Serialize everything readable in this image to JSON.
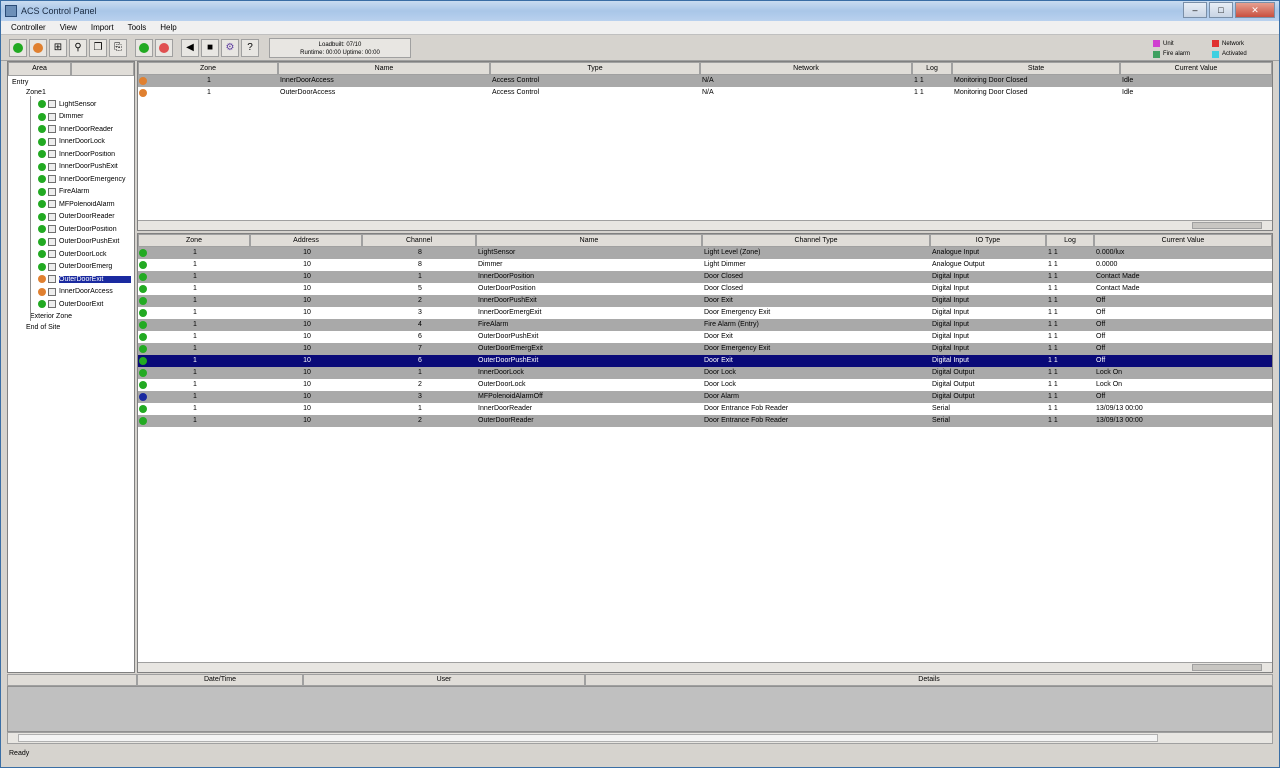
{
  "window": {
    "title": "ACS Control Panel"
  },
  "taskbar_tabs": [
    "",
    "",
    "",
    "",
    "",
    "",
    ""
  ],
  "menu": [
    "Controller",
    "View",
    "Import",
    "Tools",
    "Help"
  ],
  "clock": {
    "line1": "Loadbuilt: 07/10",
    "line2": "Runtime: 00:00   Uptime: 00:00"
  },
  "legend": [
    {
      "label": "Unit",
      "color": "#d040d0"
    },
    {
      "label": "Network",
      "color": "#e03030"
    },
    {
      "label": "Fire alarm",
      "color": "#40a060"
    },
    {
      "label": "Activated",
      "color": "#40d0e0"
    }
  ],
  "left_panel": {
    "tabs": [
      "Area",
      ""
    ],
    "root": "Entry",
    "zone": "Zone1",
    "items": [
      {
        "label": "LightSensor",
        "color": "#22aa22",
        "selected": false
      },
      {
        "label": "Dimmer",
        "color": "#22aa22",
        "selected": false
      },
      {
        "label": "InnerDoorReader",
        "color": "#22aa22",
        "selected": false
      },
      {
        "label": "InnerDoorLock",
        "color": "#22aa22",
        "selected": false
      },
      {
        "label": "InnerDoorPosition",
        "color": "#22aa22",
        "selected": false
      },
      {
        "label": "InnerDoorPushExit",
        "color": "#22aa22",
        "selected": false
      },
      {
        "label": "InnerDoorEmergency",
        "color": "#22aa22",
        "selected": false
      },
      {
        "label": "FireAlarm",
        "color": "#22aa22",
        "selected": false
      },
      {
        "label": "MFPolenoidAlarm",
        "color": "#22aa22",
        "selected": false
      },
      {
        "label": "OuterDoorReader",
        "color": "#22aa22",
        "selected": false
      },
      {
        "label": "OuterDoorPosition",
        "color": "#22aa22",
        "selected": false
      },
      {
        "label": "OuterDoorPushExit",
        "color": "#22aa22",
        "selected": false
      },
      {
        "label": "OuterDoorLock",
        "color": "#22aa22",
        "selected": false
      },
      {
        "label": "OuterDoorEmerg",
        "color": "#22aa22",
        "selected": false
      },
      {
        "label": "OuterDoorExit",
        "color": "#e08030",
        "selected": true
      },
      {
        "label": "InnerDoorAccess",
        "color": "#e08030",
        "selected": false
      },
      {
        "label": "OuterDoorExit",
        "color": "#22aa22",
        "selected": false
      }
    ],
    "tail": [
      "Exterior Zone",
      "End of Site"
    ]
  },
  "top_grid": {
    "columns": [
      "Zone",
      "Name",
      "Type",
      "Network",
      "Log",
      "State",
      "Current Value"
    ],
    "rows": [
      {
        "dot": "#e08030",
        "cells": [
          "1",
          "InnerDoorAccess",
          "Access Control",
          "N/A",
          "1  1",
          "Monitoring Door Closed",
          "Idle"
        ]
      },
      {
        "dot": "#e08030",
        "cells": [
          "1",
          "OuterDoorAccess",
          "Access Control",
          "N/A",
          "1  1",
          "Monitoring Door Closed",
          "Idle"
        ]
      }
    ]
  },
  "mid_grid": {
    "columns": [
      "Zone",
      "Address",
      "Channel",
      "Name",
      "Channel Type",
      "IO Type",
      "Log",
      "Current Value"
    ],
    "rows": [
      {
        "dot": "#22aa22",
        "cells": [
          "1",
          "10",
          "8",
          "LightSensor",
          "Light Level (Zone)",
          "Analogue Input",
          "1  1",
          "0.000/lux"
        ]
      },
      {
        "dot": "#22aa22",
        "cells": [
          "1",
          "10",
          "8",
          "Dimmer",
          "Light Dimmer",
          "Analogue Output",
          "1  1",
          "0.0000"
        ]
      },
      {
        "dot": "#22aa22",
        "cells": [
          "1",
          "10",
          "1",
          "InnerDoorPosition",
          "Door Closed",
          "Digital Input",
          "1  1",
          "Contact Made"
        ]
      },
      {
        "dot": "#22aa22",
        "cells": [
          "1",
          "10",
          "5",
          "OuterDoorPosition",
          "Door Closed",
          "Digital Input",
          "1  1",
          "Contact Made"
        ]
      },
      {
        "dot": "#22aa22",
        "cells": [
          "1",
          "10",
          "2",
          "InnerDoorPushExit",
          "Door Exit",
          "Digital Input",
          "1  1",
          "Off"
        ]
      },
      {
        "dot": "#22aa22",
        "cells": [
          "1",
          "10",
          "3",
          "InnerDoorEmergExit",
          "Door Emergency Exit",
          "Digital Input",
          "1  1",
          "Off"
        ]
      },
      {
        "dot": "#22aa22",
        "cells": [
          "1",
          "10",
          "4",
          "FireAlarm",
          "Fire Alarm (Entry)",
          "Digital Input",
          "1  1",
          "Off"
        ]
      },
      {
        "dot": "#22aa22",
        "cells": [
          "1",
          "10",
          "6",
          "OuterDoorPushExit",
          "Door Exit",
          "Digital Input",
          "1  1",
          "Off"
        ]
      },
      {
        "dot": "#22aa22",
        "cells": [
          "1",
          "10",
          "7",
          "OuterDoorEmergExit",
          "Door Emergency Exit",
          "Digital Input",
          "1  1",
          "Off"
        ]
      },
      {
        "dot": "#22aa22",
        "cells": [
          "1",
          "10",
          "6",
          "OuterDoorPushExit",
          "Door Exit",
          "Digital Input",
          "1  1",
          "Off"
        ],
        "selected": true
      },
      {
        "dot": "#22aa22",
        "cells": [
          "1",
          "10",
          "1",
          "InnerDoorLock",
          "Door Lock",
          "Digital Output",
          "1  1",
          "Lock On"
        ]
      },
      {
        "dot": "#22aa22",
        "cells": [
          "1",
          "10",
          "2",
          "OuterDoorLock",
          "Door Lock",
          "Digital Output",
          "1  1",
          "Lock On"
        ]
      },
      {
        "dot": "#1a2aa0",
        "cells": [
          "1",
          "10",
          "3",
          "MFPolenoidAlarmOff",
          "Door Alarm",
          "Digital Output",
          "1  1",
          "Off"
        ]
      },
      {
        "dot": "#22aa22",
        "cells": [
          "1",
          "10",
          "1",
          "InnerDoorReader",
          "Door Entrance Fob Reader",
          "Serial",
          "1  1",
          "13/09/13 00:00"
        ]
      },
      {
        "dot": "#22aa22",
        "cells": [
          "1",
          "10",
          "2",
          "OuterDoorReader",
          "Door Entrance Fob Reader",
          "Serial",
          "1  1",
          "13/09/13 00:00"
        ]
      }
    ]
  },
  "log": {
    "columns": [
      "",
      "Date/Time",
      "User",
      "Details"
    ]
  },
  "status": "Ready"
}
